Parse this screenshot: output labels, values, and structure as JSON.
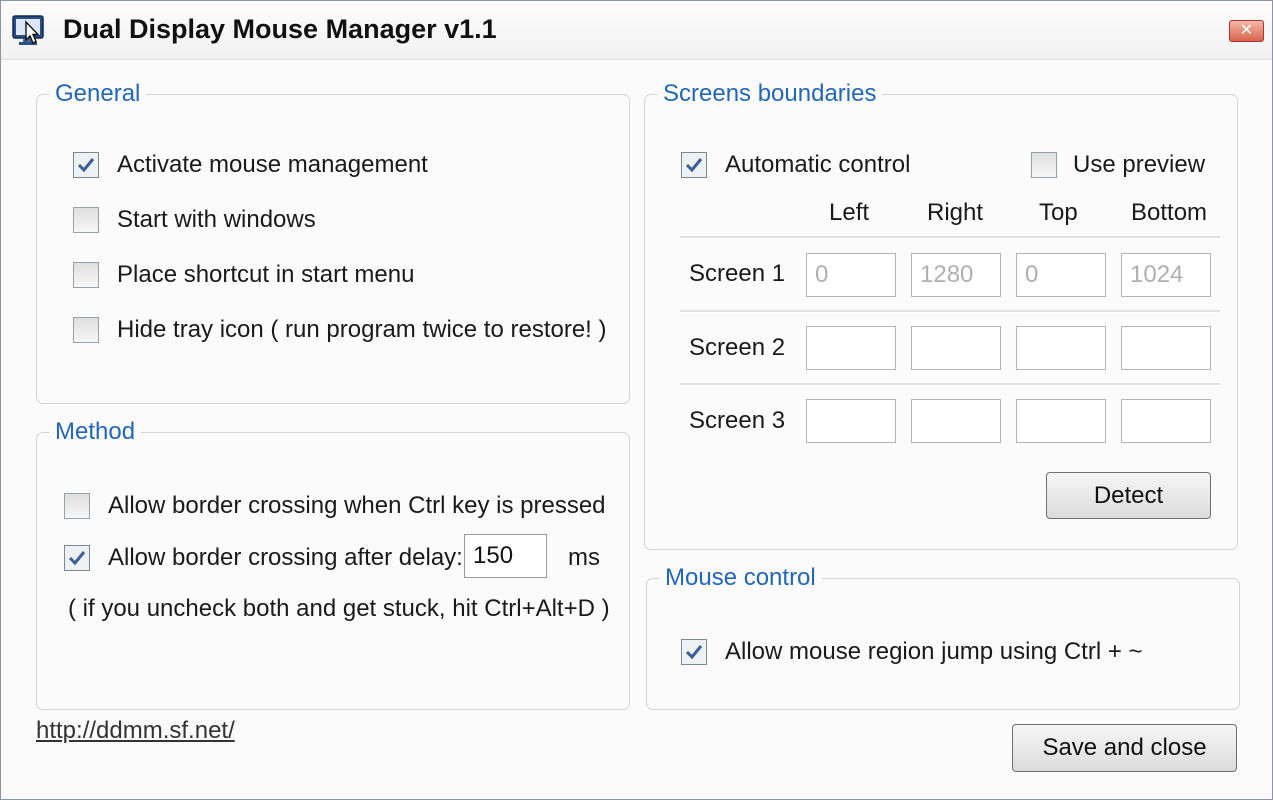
{
  "window": {
    "title": "Dual Display Mouse Manager v1.1",
    "close_label": "✕",
    "app_icon": "monitor-cursor-icon"
  },
  "general": {
    "legend": "General",
    "options": [
      {
        "label": "Activate mouse management",
        "checked": true
      },
      {
        "label": "Start with windows",
        "checked": false
      },
      {
        "label": "Place shortcut in start menu",
        "checked": false
      },
      {
        "label": "Hide tray icon ( run program twice to restore! )",
        "checked": false
      }
    ]
  },
  "method": {
    "legend": "Method",
    "ctrl_option": {
      "label": "Allow border crossing when Ctrl key is pressed",
      "checked": false
    },
    "delay_option": {
      "label": "Allow border crossing after delay:",
      "checked": true
    },
    "delay_value": "150",
    "delay_unit": "ms",
    "hint": "( if you uncheck both and get stuck, hit Ctrl+Alt+D )"
  },
  "screens": {
    "legend": "Screens boundaries",
    "automatic": {
      "label": "Automatic control",
      "checked": true
    },
    "preview": {
      "label": "Use preview",
      "checked": false
    },
    "columns": [
      "Left",
      "Right",
      "Top",
      "Bottom"
    ],
    "rows": [
      {
        "label": "Screen 1",
        "values": [
          "0",
          "1280",
          "0",
          "1024"
        ]
      },
      {
        "label": "Screen 2",
        "values": [
          "",
          "",
          "",
          ""
        ]
      },
      {
        "label": "Screen 3",
        "values": [
          "",
          "",
          "",
          ""
        ]
      }
    ],
    "detect_label": "Detect"
  },
  "mouse_control": {
    "legend": "Mouse control",
    "region_jump": {
      "label": "Allow mouse region jump using Ctrl + ~",
      "checked": true
    }
  },
  "footer": {
    "link": "http://ddmm.sf.net/",
    "save_label": "Save and close"
  }
}
